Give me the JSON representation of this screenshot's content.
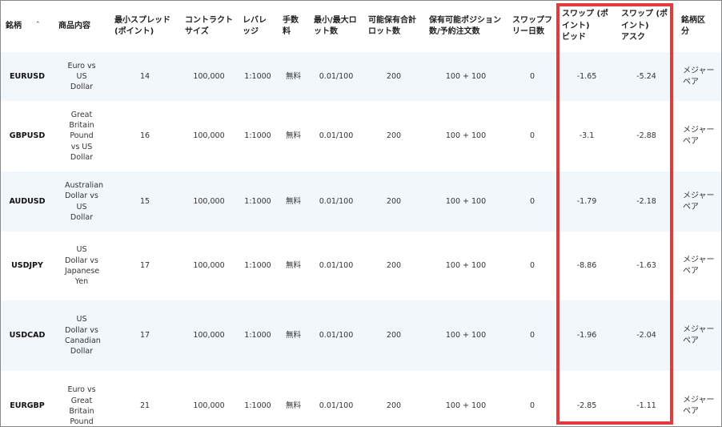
{
  "table": {
    "headers": [
      "銘柄",
      "商品内容",
      "最小スプレッド\n(ポイント)",
      "コントラクト\nサイズ",
      "レバレ\nッジ",
      "手数\n料",
      "最小/最大ロ\nット数",
      "可能保有合計\nロット数",
      "保有可能ポジション\n数/予約注文数",
      "スワップフ\nリー日数",
      "スワップ (ポ\nイント)\nビッド",
      "スワップ (ポ\nイント)\nアスク",
      "銘柄区\n分"
    ],
    "sort_indicator": "ˆ",
    "rows": [
      {
        "symbol": "EURUSD",
        "description": "Euro vs US Dollar",
        "min_spread": "14",
        "contract_size": "100,000",
        "leverage": "1:1000",
        "commission": "無料",
        "lot_min_max": "0.01/100",
        "total_lots": "200",
        "positions_orders": "100 + 100",
        "swap_free_days": "0",
        "swap_bid": "-1.65",
        "swap_ask": "-5.24",
        "classification": "メジャーペア"
      },
      {
        "symbol": "GBPUSD",
        "description": "Great Britain Pound vs US Dollar",
        "min_spread": "16",
        "contract_size": "100,000",
        "leverage": "1:1000",
        "commission": "無料",
        "lot_min_max": "0.01/100",
        "total_lots": "200",
        "positions_orders": "100 + 100",
        "swap_free_days": "0",
        "swap_bid": "-3.1",
        "swap_ask": "-2.88",
        "classification": "メジャーペア"
      },
      {
        "symbol": "AUDUSD",
        "description": "Australian Dollar vs US Dollar",
        "min_spread": "15",
        "contract_size": "100,000",
        "leverage": "1:1000",
        "commission": "無料",
        "lot_min_max": "0.01/100",
        "total_lots": "200",
        "positions_orders": "100 + 100",
        "swap_free_days": "0",
        "swap_bid": "-1.79",
        "swap_ask": "-2.18",
        "classification": "メジャーペア"
      },
      {
        "symbol": "USDJPY",
        "description": "US Dollar vs Japanese Yen",
        "min_spread": "17",
        "contract_size": "100,000",
        "leverage": "1:1000",
        "commission": "無料",
        "lot_min_max": "0.01/100",
        "total_lots": "200",
        "positions_orders": "100 + 100",
        "swap_free_days": "0",
        "swap_bid": "-8.86",
        "swap_ask": "-1.63",
        "classification": "メジャーペア"
      },
      {
        "symbol": "USDCAD",
        "description": "US Dollar vs Canadian Dollar",
        "min_spread": "17",
        "contract_size": "100,000",
        "leverage": "1:1000",
        "commission": "無料",
        "lot_min_max": "0.01/100",
        "total_lots": "200",
        "positions_orders": "100 + 100",
        "swap_free_days": "0",
        "swap_bid": "-1.96",
        "swap_ask": "-2.04",
        "classification": "メジャーペア"
      },
      {
        "symbol": "EURGBP",
        "description": "Euro vs Great Britain Pound",
        "min_spread": "21",
        "contract_size": "100,000",
        "leverage": "1:1000",
        "commission": "無料",
        "lot_min_max": "0.01/100",
        "total_lots": "200",
        "positions_orders": "100 + 100",
        "swap_free_days": "0",
        "swap_bid": "-2.85",
        "swap_ask": "-1.11",
        "classification": "メジャーペア"
      }
    ]
  },
  "highlight": {
    "color": "#e23b3b",
    "covers": [
      "swap_bid",
      "swap_ask"
    ]
  },
  "colors": {
    "row_stripe": "#f1f7fb",
    "row_plain": "#ffffff",
    "frame_border": "#8a8a8a"
  }
}
